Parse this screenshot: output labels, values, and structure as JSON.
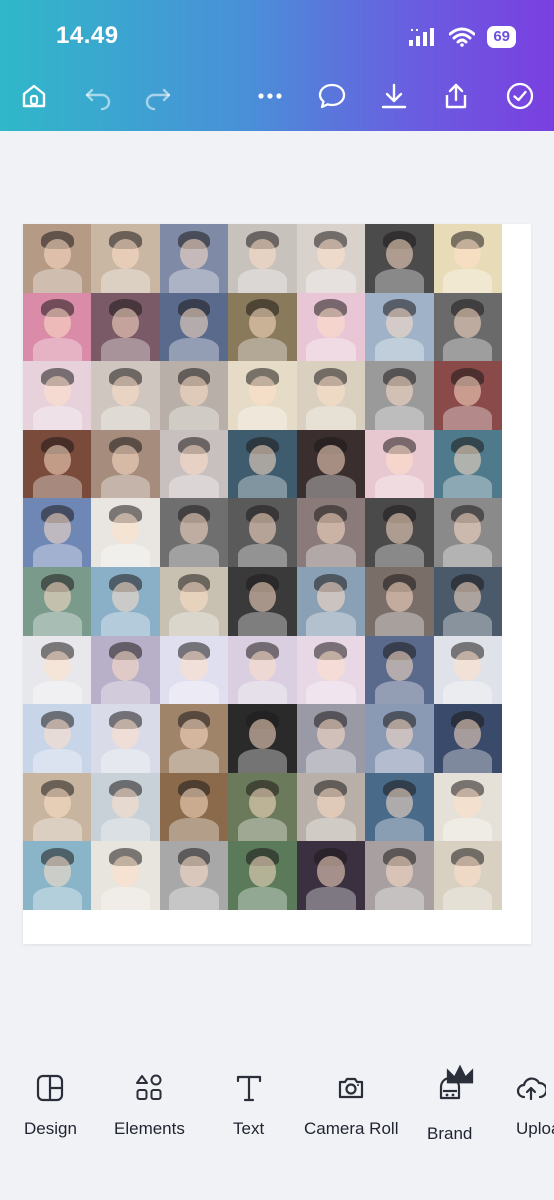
{
  "status_bar": {
    "time": "14.49",
    "battery": "69"
  },
  "toolbar": {
    "home_icon": "home-icon",
    "undo_icon": "undo-icon",
    "redo_icon": "redo-icon",
    "more_icon": "more-horizontal-icon",
    "comment_icon": "comment-icon",
    "download_icon": "download-icon",
    "share_icon": "share-icon",
    "done_icon": "check-circle-icon"
  },
  "canvas": {
    "tile_colors": [
      "#b59a86",
      "#c9b7a3",
      "#7f8aa6",
      "#c8c2bd",
      "#d9d2cc",
      "#4b4b4b",
      "#e8dcb8",
      "#d98ba7",
      "#7a5a66",
      "#5a6a8c",
      "#8a7a5c",
      "#e8c6d6",
      "#9fb2c8",
      "#6a6a6a",
      "#e7d2dc",
      "#cfc6bf",
      "#b8b0a8",
      "#e6dbc6",
      "#d9d0bf",
      "#9a9a9a",
      "#8a4a4a",
      "#7a4a3a",
      "#a58c7c",
      "#c8bfbf",
      "#3e5c6e",
      "#3a2e2e",
      "#e8c8d0",
      "#4e7a8c",
      "#6f87b5",
      "#e9e6e1",
      "#6f6f6f",
      "#5a5a5a",
      "#8a7a7a",
      "#4a4a4a",
      "#8a8a8a",
      "#7a9a8c",
      "#8ab0c8",
      "#c8c0b0",
      "#3a3a3a",
      "#8aa0b5",
      "#7a6e68",
      "#4a5a6a",
      "#e8e8ec",
      "#b8b0c8",
      "#e0dff0",
      "#d9cfe0",
      "#e8d8e6",
      "#5a6a8c",
      "#dfe2e8",
      "#c8d4e8",
      "#d9dce8",
      "#a0846a",
      "#2a2a2a",
      "#9a9aa6",
      "#8a9ab5",
      "#3a4a6a",
      "#c8b5a0",
      "#c8d0d8",
      "#8a6a4a",
      "#6a7a5a",
      "#b8b0a8",
      "#4a6a8a",
      "#e6e1d8",
      "#8ab5c8",
      "#e8e4de",
      "#a8a8a8",
      "#5a7a5a",
      "#3a3040",
      "#a8a0a0",
      "#d8d0c0"
    ]
  },
  "bottom_nav": [
    {
      "label": "Design",
      "icon": "design-icon"
    },
    {
      "label": "Elements",
      "icon": "elements-icon"
    },
    {
      "label": "Text",
      "icon": "text-icon"
    },
    {
      "label": "Camera Roll",
      "icon": "camera-icon"
    },
    {
      "label": "Brand",
      "icon": "brand-icon"
    },
    {
      "label": "Uploads",
      "icon": "upload-icon"
    }
  ]
}
